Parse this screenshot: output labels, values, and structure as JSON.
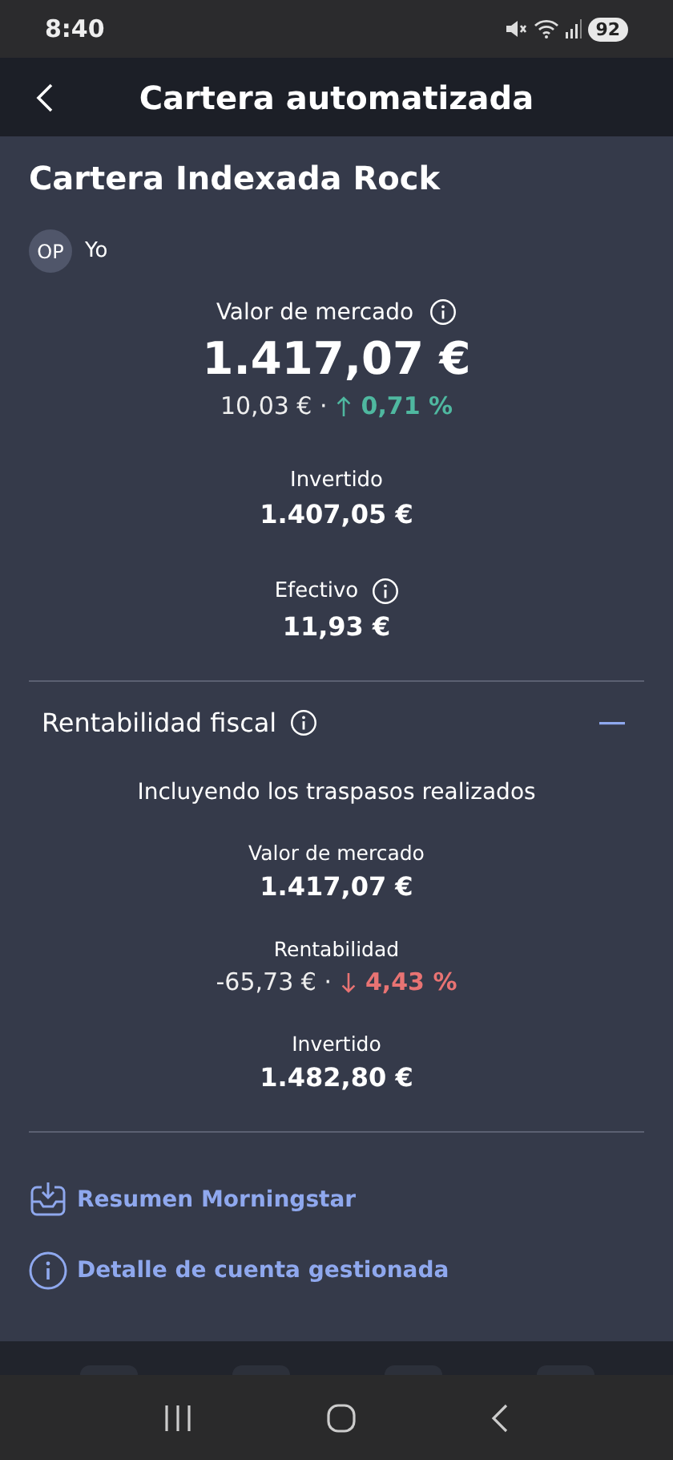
{
  "status_bar": {
    "time": "8:40",
    "battery": "92"
  },
  "header": {
    "title": "Cartera automatizada"
  },
  "portfolio": {
    "name": "Cartera Indexada Rock",
    "owner": {
      "initials": "OP",
      "name": "Yo"
    }
  },
  "summary": [
    {
      "kind": "hero",
      "label": "Valor de mercado",
      "info": true,
      "value": "1.417,07 €",
      "change_amount": "10,03 € ·",
      "rising": true,
      "change_percent": "0,71 %"
    },
    {
      "kind": "value",
      "label": "Invertido",
      "info": false,
      "value": "1.407,05 €"
    },
    {
      "kind": "value",
      "label": "Efectivo",
      "info": true,
      "value": "11,93 €"
    }
  ],
  "fiscal": {
    "title": "Rentabilidad fiscal",
    "expanded": true,
    "note": "Incluyendo los traspasos realizados",
    "items": [
      {
        "kind": "value",
        "label": "Valor de mercado",
        "value": "1.417,07 €"
      },
      {
        "kind": "change",
        "label": "Rentabilidad",
        "change_amount": "-65,73 € ·",
        "rising": false,
        "change_percent": "4,43 %"
      },
      {
        "kind": "value",
        "label": "Invertido",
        "value": "1.482,80 €"
      }
    ]
  },
  "links": [
    {
      "kind": "download",
      "label": "Resumen Morningstar"
    },
    {
      "kind": "info",
      "label": "Detalle de cuenta gestionada"
    }
  ]
}
